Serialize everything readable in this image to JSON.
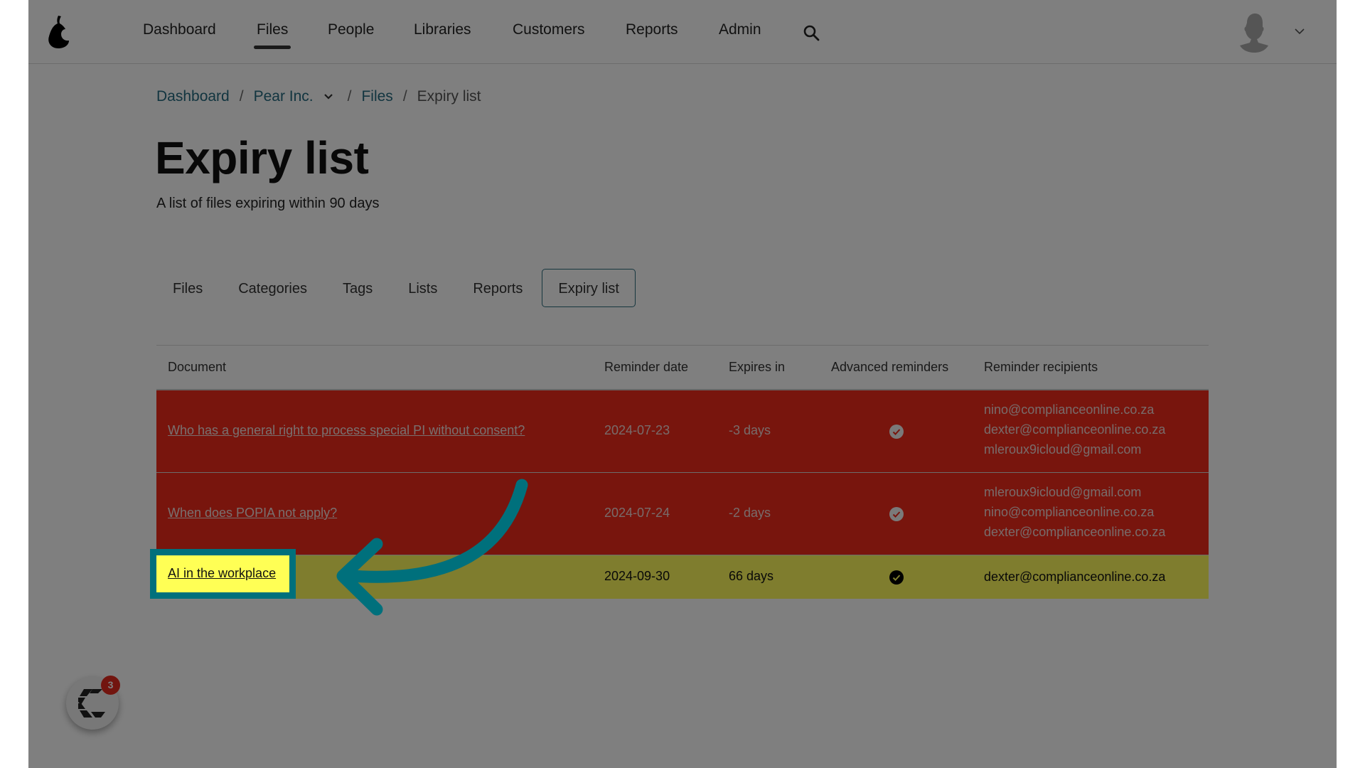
{
  "header": {
    "logo": "pear-logo-icon",
    "nav": [
      {
        "label": "Dashboard",
        "active": false
      },
      {
        "label": "Files",
        "active": true
      },
      {
        "label": "People",
        "active": false
      },
      {
        "label": "Libraries",
        "active": false
      },
      {
        "label": "Customers",
        "active": false
      },
      {
        "label": "Reports",
        "active": false
      },
      {
        "label": "Admin",
        "active": false
      }
    ],
    "search_icon": "search-icon",
    "avatar_icon": "user-avatar-icon",
    "user_menu_icon": "chevron-down-icon"
  },
  "breadcrumb": {
    "items": [
      "Dashboard",
      "Pear Inc.",
      "Files"
    ],
    "separator": "/",
    "current": "Expiry list"
  },
  "page": {
    "title": "Expiry list",
    "subtitle": "A list of files expiring within 90 days"
  },
  "tabs": [
    {
      "label": "Files",
      "active": false
    },
    {
      "label": "Categories",
      "active": false
    },
    {
      "label": "Tags",
      "active": false
    },
    {
      "label": "Lists",
      "active": false
    },
    {
      "label": "Reports",
      "active": false
    },
    {
      "label": "Expiry list",
      "active": true
    }
  ],
  "table": {
    "columns": [
      "Document",
      "Reminder date",
      "Expires in",
      "Advanced reminders",
      "Reminder recipients"
    ],
    "rows": [
      {
        "document": "Who has a general right to process special PI without consent?",
        "reminder_date": "2024-07-23",
        "expires_in": "-3 days",
        "advanced_reminders": true,
        "recipients": [
          "nino@complianceonline.co.za",
          "dexter@complianceonline.co.za",
          "mleroux9icloud@gmail.com"
        ],
        "status": "expired"
      },
      {
        "document": "When does POPIA not apply?",
        "reminder_date": "2024-07-24",
        "expires_in": "-2 days",
        "advanced_reminders": true,
        "recipients": [
          "mleroux9icloud@gmail.com",
          "nino@complianceonline.co.za",
          "dexter@complianceonline.co.za"
        ],
        "status": "expired"
      },
      {
        "document": "AI in the workplace",
        "reminder_date": "2024-09-30",
        "expires_in": "66 days",
        "advanced_reminders": true,
        "recipients": [
          "dexter@complianceonline.co.za"
        ],
        "status": "warning"
      }
    ]
  },
  "widget": {
    "icon": "chat-widget-icon",
    "badge_count": "3"
  },
  "colors": {
    "expired_row": "#f02a1b",
    "warning_row": "#fffb5c",
    "link": "#256a80",
    "highlight_border": "#00707c",
    "highlight_fill": "#ffff55",
    "badge": "#e52a1f"
  }
}
